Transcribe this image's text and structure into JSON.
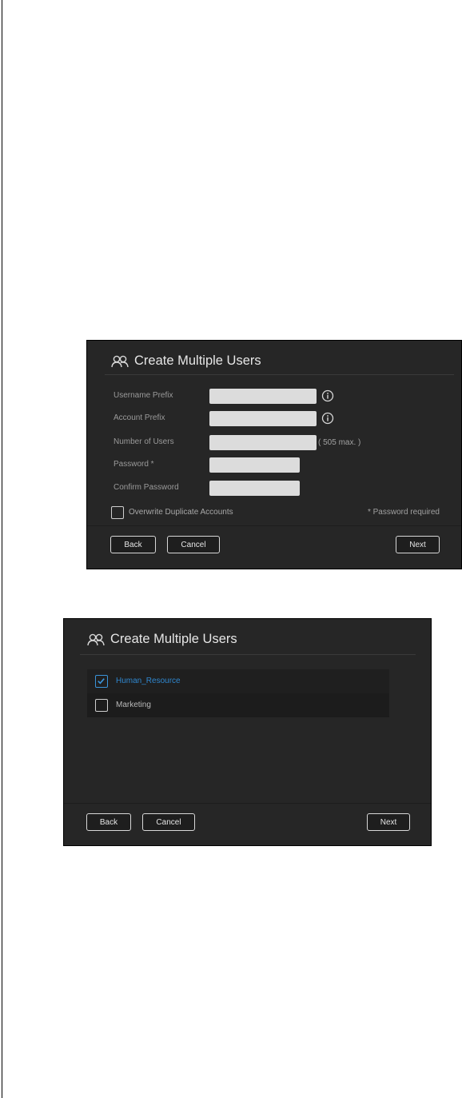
{
  "dialog_step1": {
    "title": "Create Multiple Users",
    "fields": [
      {
        "label": "Username Prefix",
        "value": "",
        "hint": ""
      },
      {
        "label": "Account Prefix",
        "value": "",
        "hint": ""
      },
      {
        "label": "Number of Users",
        "value": "",
        "hint": "( 505 max. )"
      },
      {
        "label": "Password *",
        "value": ""
      },
      {
        "label": "Confirm Password",
        "value": ""
      }
    ],
    "overwrite_label": "Overwrite Duplicate Accounts",
    "overwrite_checked": false,
    "required_note": "* Password required",
    "buttons": {
      "back": "Back",
      "cancel": "Cancel",
      "next": "Next"
    }
  },
  "dialog_step2": {
    "title": "Create Multiple Users",
    "groups": [
      {
        "label": "Human_Resource",
        "checked": true
      },
      {
        "label": "Marketing",
        "checked": false
      }
    ],
    "buttons": {
      "back": "Back",
      "cancel": "Cancel",
      "next": "Next"
    }
  },
  "colors": {
    "dialog_bg": "#262626",
    "input_bg": "#dcdcdc",
    "accent": "#2f87cf"
  },
  "icons": [
    "users-icon",
    "info-icon",
    "checkbox-icon",
    "check-icon"
  ]
}
